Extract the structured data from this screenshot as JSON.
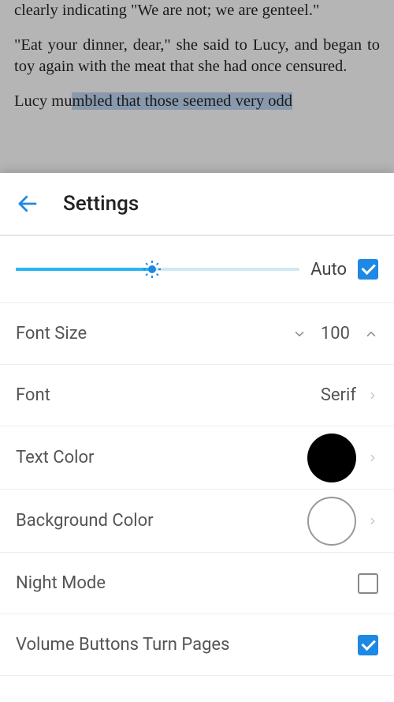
{
  "reader": {
    "p1": "clearly indicating \"We are not; we are genteel.\"",
    "p2": "\"Eat your dinner, dear,\" she said to Lucy, and began to toy again with the meat that she had once censured.",
    "p3_a": "Lucy mu",
    "p3_b": "mbled that those seemed very odd"
  },
  "panel": {
    "title": "Settings",
    "brightness": {
      "auto_label": "Auto",
      "auto_checked": true
    },
    "font_size": {
      "label": "Font Size",
      "value": "100"
    },
    "font": {
      "label": "Font",
      "value": "Serif"
    },
    "text_color": {
      "label": "Text Color",
      "value": "#000000"
    },
    "background_color": {
      "label": "Background Color",
      "value": "#ffffff"
    },
    "night_mode": {
      "label": "Night Mode",
      "checked": false
    },
    "volume_buttons": {
      "label": "Volume Buttons Turn Pages",
      "checked": true
    }
  }
}
